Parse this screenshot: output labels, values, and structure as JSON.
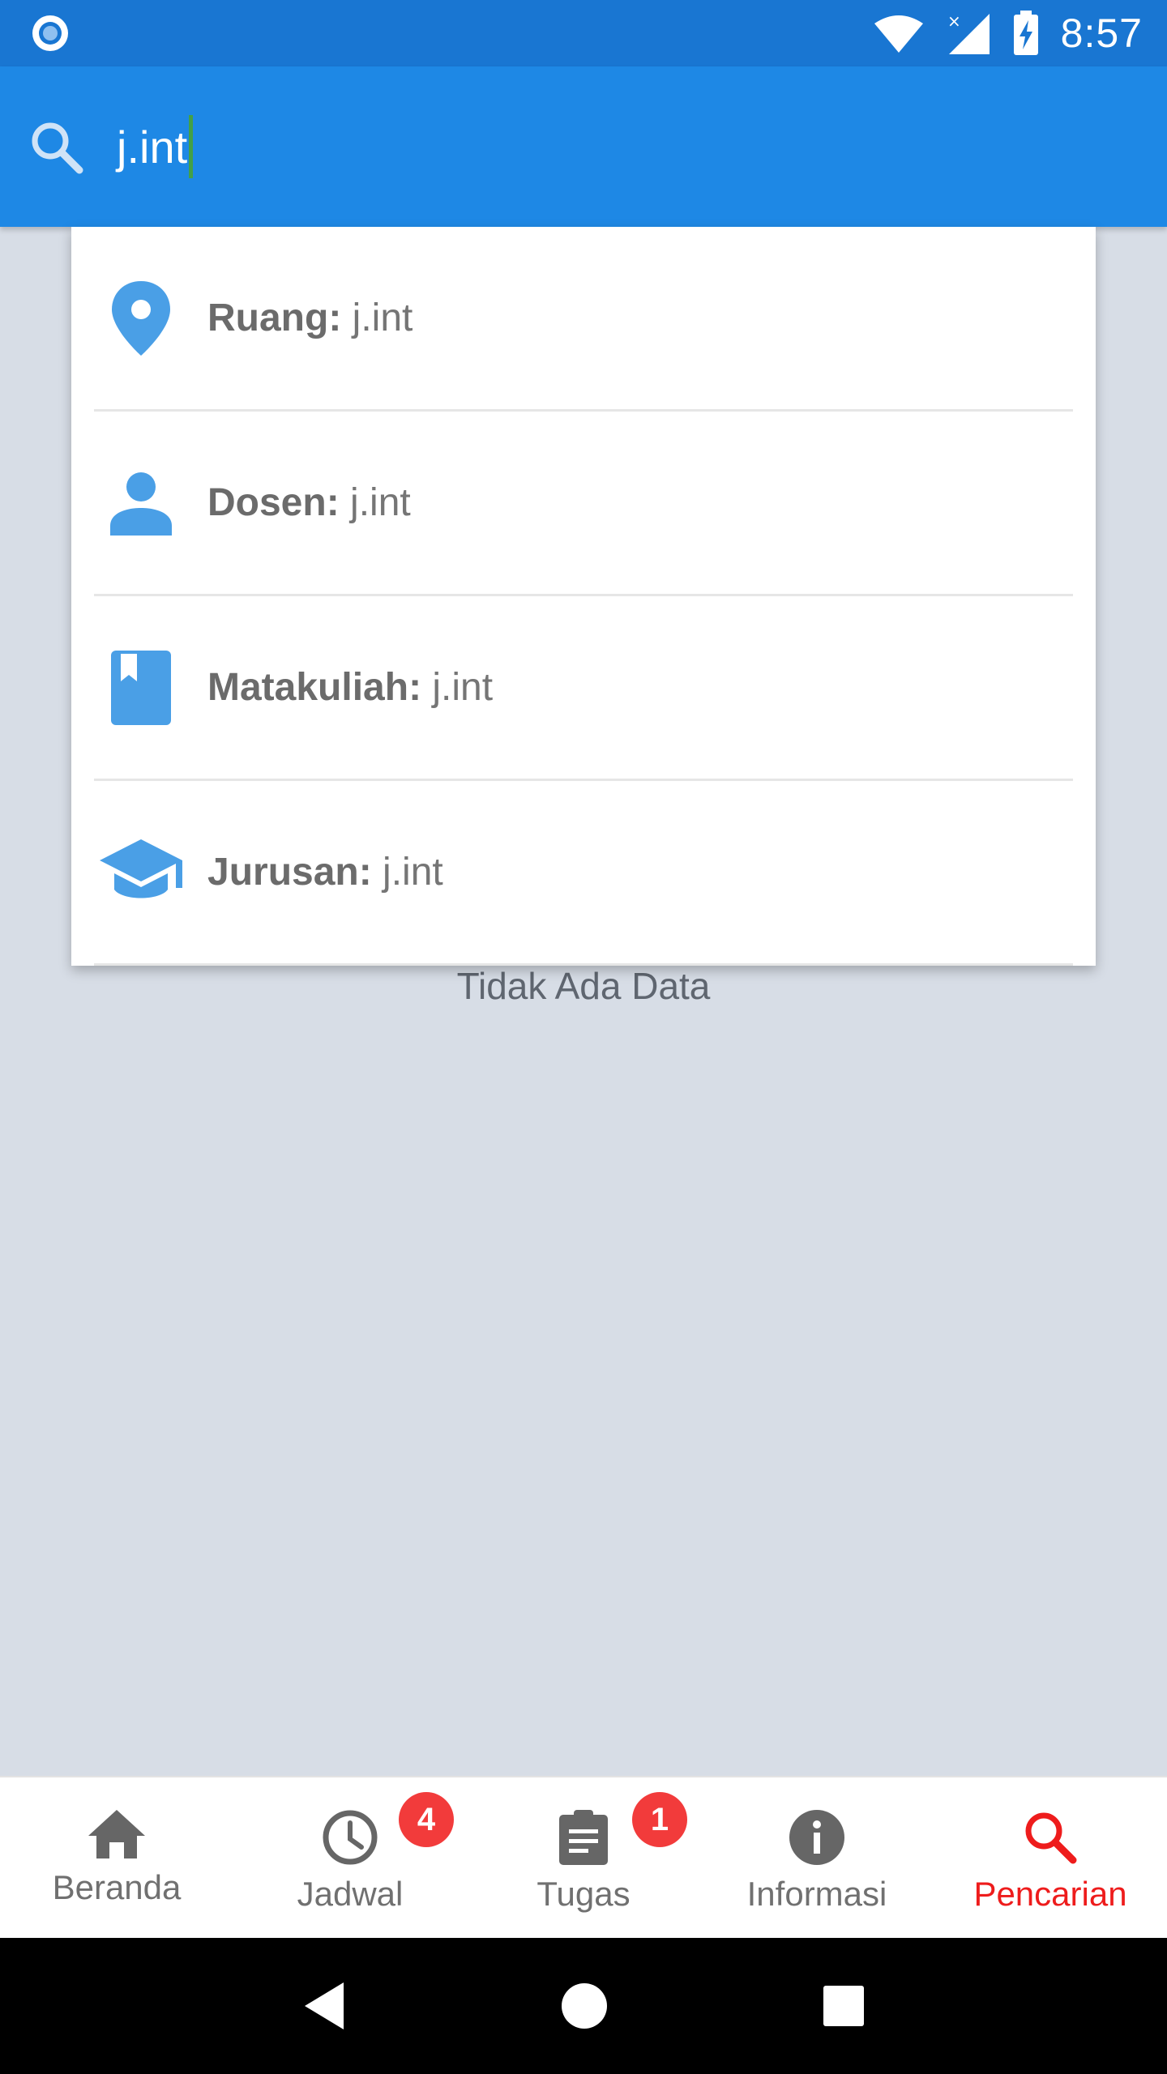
{
  "status_bar": {
    "time": "8:57"
  },
  "search": {
    "query": "j.int",
    "icon": "search-icon"
  },
  "suggestions": [
    {
      "icon": "location-pin-icon",
      "label": "Ruang:",
      "value": " j.int"
    },
    {
      "icon": "person-icon",
      "label": "Dosen:",
      "value": " j.int"
    },
    {
      "icon": "book-icon",
      "label": "Matakuliah:",
      "value": " j.int"
    },
    {
      "icon": "graduation-cap-icon",
      "label": "Jurusan:",
      "value": " j.int"
    }
  ],
  "empty_state": "Tidak Ada Data",
  "bottom_nav": {
    "items": [
      {
        "label": "Beranda",
        "icon": "home-icon"
      },
      {
        "label": "Jadwal",
        "icon": "clock-icon",
        "badge": "4"
      },
      {
        "label": "Tugas",
        "icon": "clipboard-icon",
        "badge": "1"
      },
      {
        "label": "Informasi",
        "icon": "info-icon"
      },
      {
        "label": "Pencarian",
        "icon": "search-icon",
        "active": true
      }
    ]
  },
  "colors": {
    "status_bar": "#1976d2",
    "app_bar": "#1e88e5",
    "accent_icon": "#4a9fe6",
    "active_nav": "#ee1c1c",
    "badge": "#f23b3b",
    "background": "#d7dde6"
  }
}
